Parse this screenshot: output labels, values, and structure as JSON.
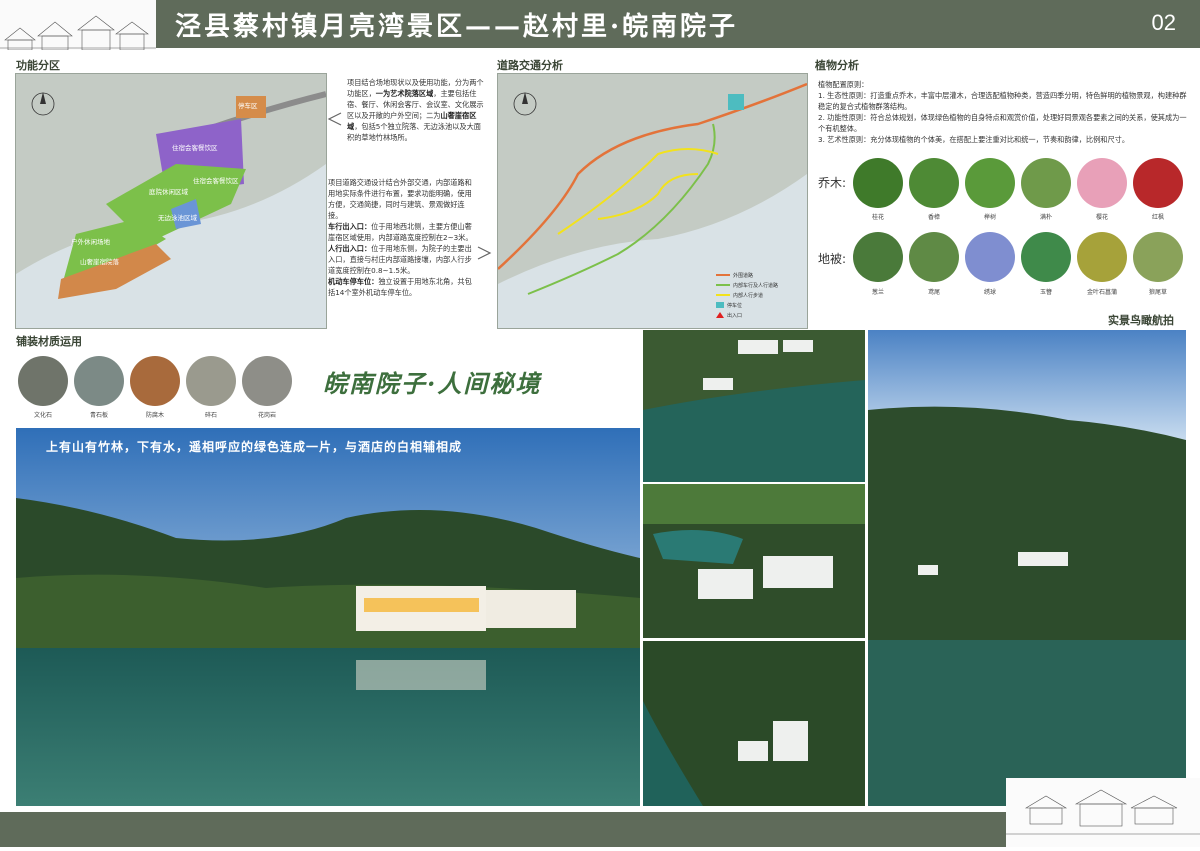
{
  "header": {
    "title": "泾县蔡村镇月亮湾景区——赵村里·皖南院子",
    "page_number": "02"
  },
  "sections": {
    "functional_zoning": "功能分区",
    "road_traffic": "道路交通分析",
    "plant_analysis": "植物分析",
    "paving": "铺装材质运用",
    "aerial_photo": "实景鸟瞰航拍"
  },
  "zoning_map": {
    "labels": [
      "停车区",
      "住宿会客餐饮区",
      "住宿会客餐饮区",
      "庭院休闲区域",
      "无边泳池区域",
      "户外休闲场地",
      "山奢崖宿院落"
    ],
    "colors": {
      "purple": "#8e63c9",
      "green": "#7cc04a",
      "orange": "#d2884a",
      "blue": "#6a95d6"
    }
  },
  "zoning_text": {
    "p1_a": "项目结合场地现状以及使用功能，分为两个功能区，",
    "p1_b": "一为艺术院落区域",
    "p1_c": "，主要包括住宿、餐厅、休闲会客厅、会议室、文化展示区以及开敞的户外空间；二为",
    "p1_d": "山奢崖宿区域",
    "p1_e": "，包括5个独立院落、无边泳池以及大面积的草地竹林场所。"
  },
  "traffic_text": {
    "intro": "项目道路交通设计结合外部交通，内部道路和用地实际条件进行布置，要求功能明确，使用方便，交通简捷，同时与建筑、景观做好连接。",
    "car_head": "车行出入口：",
    "car_body": "位于用地西北侧，主要方便山奢崖宿区域使用，内部道路宽度控制在2~3米。",
    "ped_head": "人行出入口：",
    "ped_body": "位于用地东侧，为院子的主要出入口，直接与村庄内部道路接壤，内部人行步道宽度控制在0.8~1.5米。",
    "park_head": "机动车停车位：",
    "park_body": "独立设置于用地东北角，共包括14个室外机动车停车位。"
  },
  "traffic_legend": [
    {
      "label": "外围道路",
      "color": "#e3733a"
    },
    {
      "label": "内部车行及人行道路",
      "color": "#7cc04a"
    },
    {
      "label": "内部人行步道",
      "color": "#f2e21c"
    },
    {
      "label": "停车位",
      "color": "#4dbcc0"
    },
    {
      "label": "出入口",
      "color": "#e02020"
    }
  ],
  "plant_text": {
    "heading": "植物配置原则：",
    "p1": "1. 生态性原则：打造重点乔木，丰富中层灌木，合理选配植物种类，营造四季分明，特色鲜明的植物景观，构建种群稳定的复合式植物群落结构。",
    "p2": "2. 功能性原则：符合总体规划，体现绿色植物的自身特点和观赏价值，处理好同景观各要素之间的关系，使其成为一个有机整体。",
    "p3": "3. 艺术性原则：充分体现植物的个体美，在搭配上要注重对比和统一，节奏和韵律，比例和尺寸。"
  },
  "trees": {
    "label": "乔木:",
    "items": [
      {
        "name": "桂花",
        "color": "#3f7a2a"
      },
      {
        "name": "香樟",
        "color": "#4e8a35"
      },
      {
        "name": "榉树",
        "color": "#5a9a3a"
      },
      {
        "name": "满朴",
        "color": "#6f9a4a"
      },
      {
        "name": "樱花",
        "color": "#e8a0b8"
      },
      {
        "name": "红枫",
        "color": "#b8282a"
      }
    ]
  },
  "groundcover": {
    "label": "地被:",
    "items": [
      {
        "name": "葱兰",
        "color": "#4a7a3a"
      },
      {
        "name": "鸢尾",
        "color": "#5f8a45"
      },
      {
        "name": "绣球",
        "color": "#7f8ed0"
      },
      {
        "name": "玉簪",
        "color": "#3f8a4a"
      },
      {
        "name": "金叶石菖蒲",
        "color": "#a6a23a"
      },
      {
        "name": "狼尾草",
        "color": "#8aa25a"
      }
    ]
  },
  "paving": {
    "items": [
      {
        "name": "文化石",
        "color": "#6f746a"
      },
      {
        "name": "青石板",
        "color": "#7c8a86"
      },
      {
        "name": "防腐木",
        "color": "#a86a3c"
      },
      {
        "name": "碎石",
        "color": "#9a9a8e"
      },
      {
        "name": "花岗岩",
        "color": "#8e8e88"
      }
    ]
  },
  "slogan": "皖南院子·人间秘境",
  "main_photo_caption": "上有山有竹林，下有水，遥相呼应的绿色连成一片，与酒店的白相辅相成"
}
